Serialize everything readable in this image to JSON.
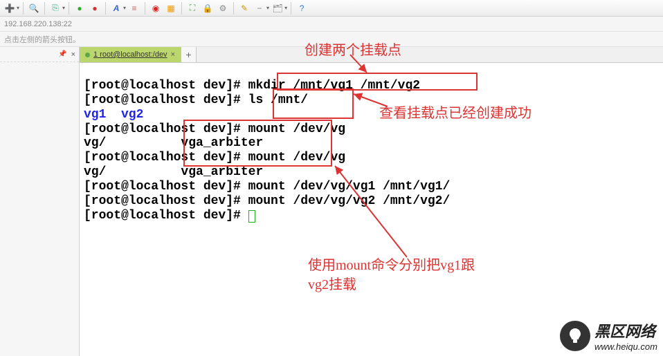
{
  "toolbar": {
    "icons": [
      "plus",
      "search",
      "copy",
      "globe-green",
      "globe-red",
      "font",
      "lines",
      "red-circle",
      "orange-box",
      "fullscreen",
      "lock",
      "gear",
      "snippet",
      "minus",
      "folders",
      "help"
    ]
  },
  "address": "192.168.220.138:22",
  "hint": "点击左侧的箭头按钮。",
  "sidepane": {
    "pin": "📌",
    "close": "×"
  },
  "tabs": {
    "active_label": "1 root@localhost:/dev",
    "close": "×",
    "add": "+"
  },
  "terminal": {
    "lines": [
      {
        "prompt": "[root@localhost dev]# ",
        "cmd": "mkdir /mnt/vg1 /mnt/vg2"
      },
      {
        "prompt": "[root@localhost dev]# ",
        "cmd": "ls /mnt/"
      },
      {
        "blue": "vg1  vg2"
      },
      {
        "prompt": "[root@localhost dev]# ",
        "cmd": "mount /dev/vg"
      },
      {
        "plain": "vg/          vga_arbiter"
      },
      {
        "prompt": "[root@localhost dev]# ",
        "cmd": "mount /dev/vg"
      },
      {
        "plain": "vg/          vga_arbiter"
      },
      {
        "prompt": "[root@localhost dev]# ",
        "cmd": "mount /dev/vg/vg1 /mnt/vg1/"
      },
      {
        "prompt": "[root@localhost dev]# ",
        "cmd": "mount /dev/vg/vg2 /mnt/vg2/"
      },
      {
        "prompt": "[root@localhost dev]# ",
        "cursor": true
      }
    ]
  },
  "annotations": {
    "a1": "创建两个挂载点",
    "a2": "查看挂载点已经创建成功",
    "a3_l1": "使用mount命令分别把vg1跟",
    "a3_l2": "vg2挂载"
  },
  "watermark": {
    "title": "黑区网络",
    "url": "www.heiqu.com"
  }
}
